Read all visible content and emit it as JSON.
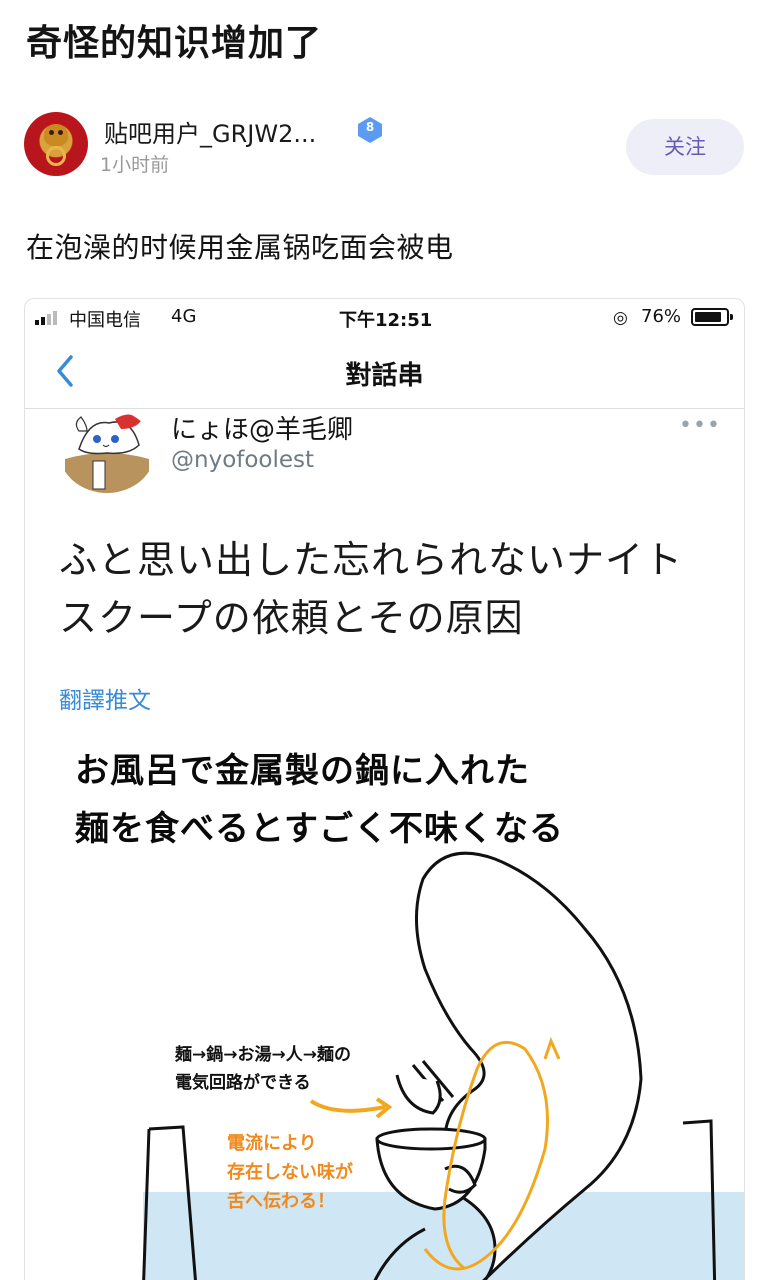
{
  "post": {
    "title": "奇怪的知识增加了",
    "author": "贴吧用户_GRJW2...",
    "level": "8",
    "time": "1小时前",
    "follow_label": "关注",
    "body": "在泡澡的时候用金属锅吃面会被电"
  },
  "screenshot": {
    "status": {
      "carrier": "中国电信",
      "network": "4G",
      "time": "下午12:51",
      "battery": "76%"
    },
    "nav": {
      "title": "對話串"
    },
    "tweet": {
      "name": "にょほ@羊毛卿",
      "handle": "@nyofoolest",
      "text_line1": "ふと思い出した忘れられないナイト",
      "text_line2": "スクープの依頼とその原因",
      "translate_label": "翻譯推文"
    },
    "comic": {
      "title_line1": "お風呂で金属製の鍋に入れた",
      "title_line2": "麺を食べるとすごく不味くなる",
      "note_line1": "麺→鍋→お湯→人→麺の",
      "note_line2": "電気回路ができる",
      "orange_line1": "電流により",
      "orange_line2": "存在しない味が",
      "orange_line3": "舌へ伝わる！"
    }
  },
  "colors": {
    "follow_text": "#6a5ab8",
    "follow_bg": "#eeeef8",
    "link_blue": "#3a8bd6",
    "handle_gray": "#6f7b84",
    "comic_orange": "#f08a1c",
    "water_blue": "#cfe6f4",
    "badge_blue": "#5b9cf2"
  }
}
